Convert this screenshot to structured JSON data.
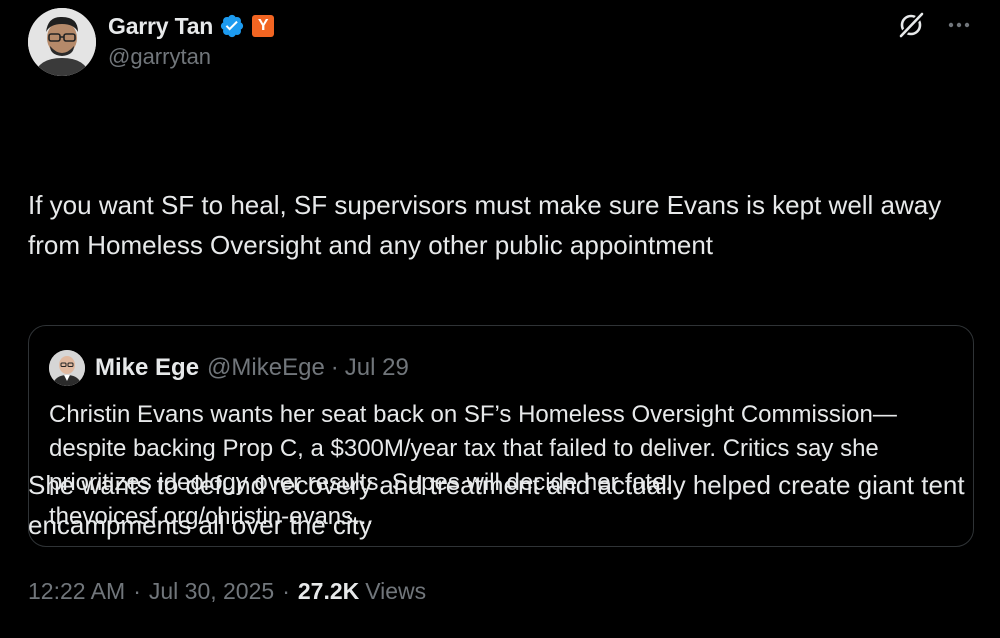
{
  "author": {
    "name": "Garry Tan",
    "handle": "@garrytan",
    "badge_letter": "Y",
    "verified_color": "#1d9bf0",
    "badge_color": "#f26522",
    "avatar_icon": "person-avatar"
  },
  "actions": {
    "grok_icon": "grok-icon",
    "more_icon": "more-options-icon"
  },
  "tweet": {
    "line1": "If you want SF to heal, SF supervisors must make sure Evans is kept well away from Homeless Oversight and any other public appointment",
    "line2": "She wants to defund recovery and treatment and actually helped create giant tent encampments all over the city"
  },
  "quote": {
    "name": "Mike Ege",
    "handle": "@MikeEge",
    "separator": "·",
    "date": "Jul 29",
    "text": "Christin Evans wants her seat back on SF’s Homeless Oversight Commission—despite backing Prop C, a $300M/year tax that failed to deliver. Critics say she prioritizes ideology over results. Supes will decide her fate.",
    "link": "thevoicesf.org/christin-evans..."
  },
  "meta": {
    "time": "12:22 AM",
    "separator": "·",
    "date": "Jul 30, 2025",
    "views_count": "27.2K",
    "views_label": "Views"
  }
}
